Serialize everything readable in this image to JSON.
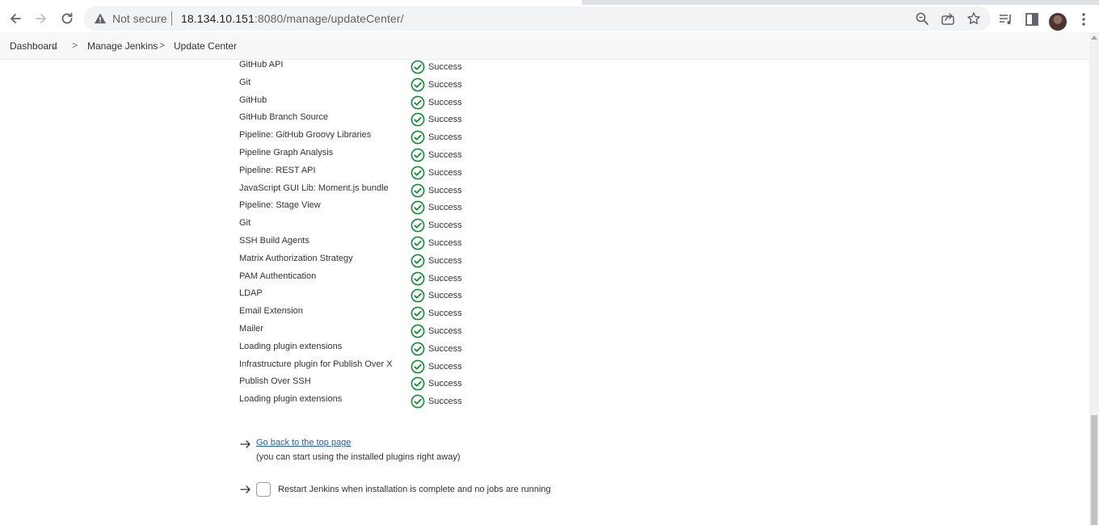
{
  "browser": {
    "security_label": "Not secure",
    "url_host": "18.134.10.151",
    "url_path": ":8080/manage/updateCenter/"
  },
  "breadcrumb": {
    "items": [
      "Dashboard",
      "Manage Jenkins",
      "Update Center"
    ],
    "separator": ">"
  },
  "plugins": [
    {
      "name": "GitHub API",
      "status": "Success"
    },
    {
      "name": "Git",
      "status": "Success"
    },
    {
      "name": "GitHub",
      "status": "Success"
    },
    {
      "name": "GitHub Branch Source",
      "status": "Success"
    },
    {
      "name": "Pipeline: GitHub Groovy Libraries",
      "status": "Success"
    },
    {
      "name": "Pipeline Graph Analysis",
      "status": "Success"
    },
    {
      "name": "Pipeline: REST API",
      "status": "Success"
    },
    {
      "name": "JavaScript GUI Lib: Moment.js bundle",
      "status": "Success"
    },
    {
      "name": "Pipeline: Stage View",
      "status": "Success"
    },
    {
      "name": "Git",
      "status": "Success"
    },
    {
      "name": "SSH Build Agents",
      "status": "Success"
    },
    {
      "name": "Matrix Authorization Strategy",
      "status": "Success"
    },
    {
      "name": "PAM Authentication",
      "status": "Success"
    },
    {
      "name": "LDAP",
      "status": "Success"
    },
    {
      "name": "Email Extension",
      "status": "Success"
    },
    {
      "name": "Mailer",
      "status": "Success"
    },
    {
      "name": "Loading plugin extensions",
      "status": "Success"
    },
    {
      "name": "Infrastructure plugin for Publish Over X",
      "status": "Success"
    },
    {
      "name": "Publish Over SSH",
      "status": "Success"
    },
    {
      "name": "Loading plugin extensions",
      "status": "Success"
    }
  ],
  "footer": {
    "back_link": "Go back to the top page",
    "back_note": "(you can start using the installed plugins right away)",
    "restart_label": "Restart Jenkins when installation is complete and no jobs are running",
    "restart_checked": false
  },
  "colors": {
    "success": "#138a36",
    "link": "#1a5ec8"
  }
}
